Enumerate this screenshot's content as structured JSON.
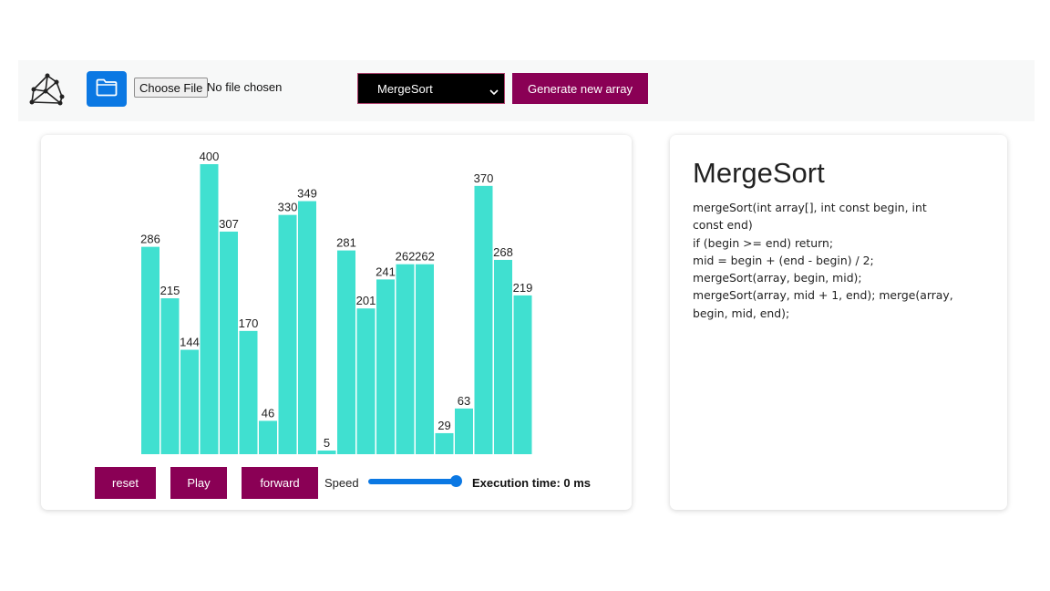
{
  "toolbar": {
    "logo_icon": "network-graph-icon",
    "folder_icon": "folder-icon",
    "choose_file_label": "Choose File",
    "no_file_text": "No file chosen",
    "algorithm_selected": "MergeSort",
    "generate_label": "Generate new array",
    "accent_color": "#8a0055",
    "folder_button_color": "#0b78e3"
  },
  "controls": {
    "reset_label": "reset",
    "play_label": "Play",
    "forward_label": "forward",
    "speed_label": "Speed",
    "speed_value": 1.0,
    "execution_time_text": "Execution time: 0 ms"
  },
  "info": {
    "title": "MergeSort",
    "code_lines": [
      "mergeSort(int array[], int const begin, int",
      "const end)",
      "if (begin >= end) return;",
      "mid = begin + (end - begin) / 2;",
      "mergeSort(array, begin, mid);",
      "mergeSort(array, mid + 1, end); merge(array,",
      "begin, mid, end);"
    ]
  },
  "chart_data": {
    "type": "bar",
    "bar_color": "#40e0d0",
    "values": [
      286,
      215,
      144,
      400,
      307,
      170,
      46,
      330,
      349,
      5,
      281,
      201,
      241,
      262,
      262,
      29,
      63,
      370,
      268,
      219
    ],
    "ylim": [
      0,
      400
    ]
  }
}
